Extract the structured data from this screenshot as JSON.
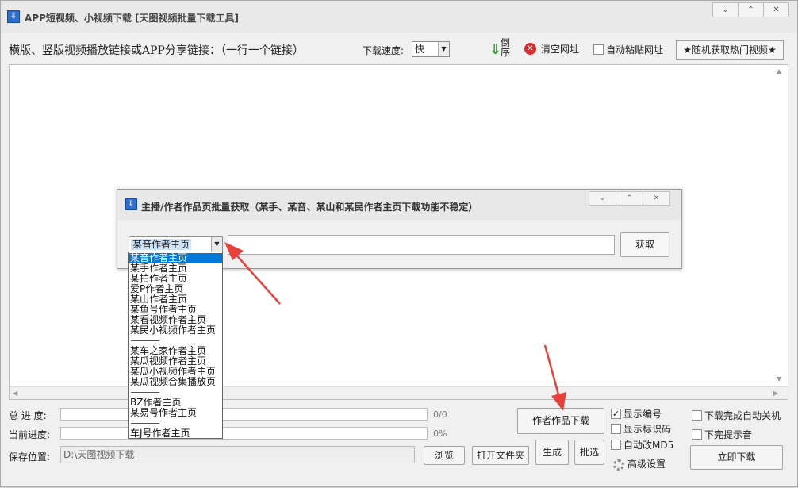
{
  "window": {
    "title": "APP短视频、小视频下载 [天图视频批量下载工具]",
    "controls": [
      "⌄",
      "⌃",
      "✕"
    ]
  },
  "toolbar": {
    "url_label": "横版、竖版视频播放链接或APP分享链接：（一行一个链接）",
    "speed_label": "下载速度:",
    "speed_value": "快",
    "reverse_label": "倒序",
    "clear_label": "清空网址",
    "auto_paste_label": "自动粘贴网址",
    "auto_paste_checked": false,
    "hot_video_label": "★随机获取热门视频★"
  },
  "main": {
    "url_text": ""
  },
  "progress": {
    "total_label": "总  进 度:",
    "total_value": "0/0",
    "current_label": "当前进度:",
    "current_value": "0%"
  },
  "save": {
    "label": "保存位置:",
    "path": "D:\\天图视频下载",
    "browse_label": "浏览",
    "open_folder_label": "打开文件夹"
  },
  "actions": {
    "author_download": "作者作品下载",
    "generate": "生成",
    "pick": "批选",
    "start_download": "立即下载",
    "advanced": "高级设置"
  },
  "options": {
    "show_number": {
      "label": "显示编号",
      "checked": true
    },
    "show_id": {
      "label": "显示标识码",
      "checked": false
    },
    "auto_md5": {
      "label": "自动改MD5",
      "checked": false
    },
    "auto_shutdown": {
      "label": "下载完成自动关机",
      "checked": false
    },
    "done_sound": {
      "label": "下完提示音",
      "checked": false
    }
  },
  "dialog": {
    "title": "主播/作者作品页批量获取（某手、某音、某山和某民作者主页下载功能不稳定）",
    "controls": [
      "⌄",
      "⌃",
      "✕"
    ],
    "selected": "某音作者主页",
    "fetch_label": "获取",
    "input_value": ""
  },
  "dropdown": {
    "items": [
      "某音作者主页",
      "某手作者主页",
      "某拍作者主页",
      "爱P作者主页",
      "某山作者主页",
      "某鱼号作者主页",
      "某看视频作者主页",
      "某民小视频作者主页",
      "某车之家作者主页",
      "某瓜视频作者主页",
      "某瓜小视频作者主页",
      "某瓜视频合集播放页",
      "BZ作者主页",
      "某易号作者主页",
      "车J号作者主页"
    ],
    "selected_index": 0
  },
  "colors": {
    "accent": "#0078d7",
    "clear_icon": "#e0292d",
    "arrow": "#e8413a"
  }
}
